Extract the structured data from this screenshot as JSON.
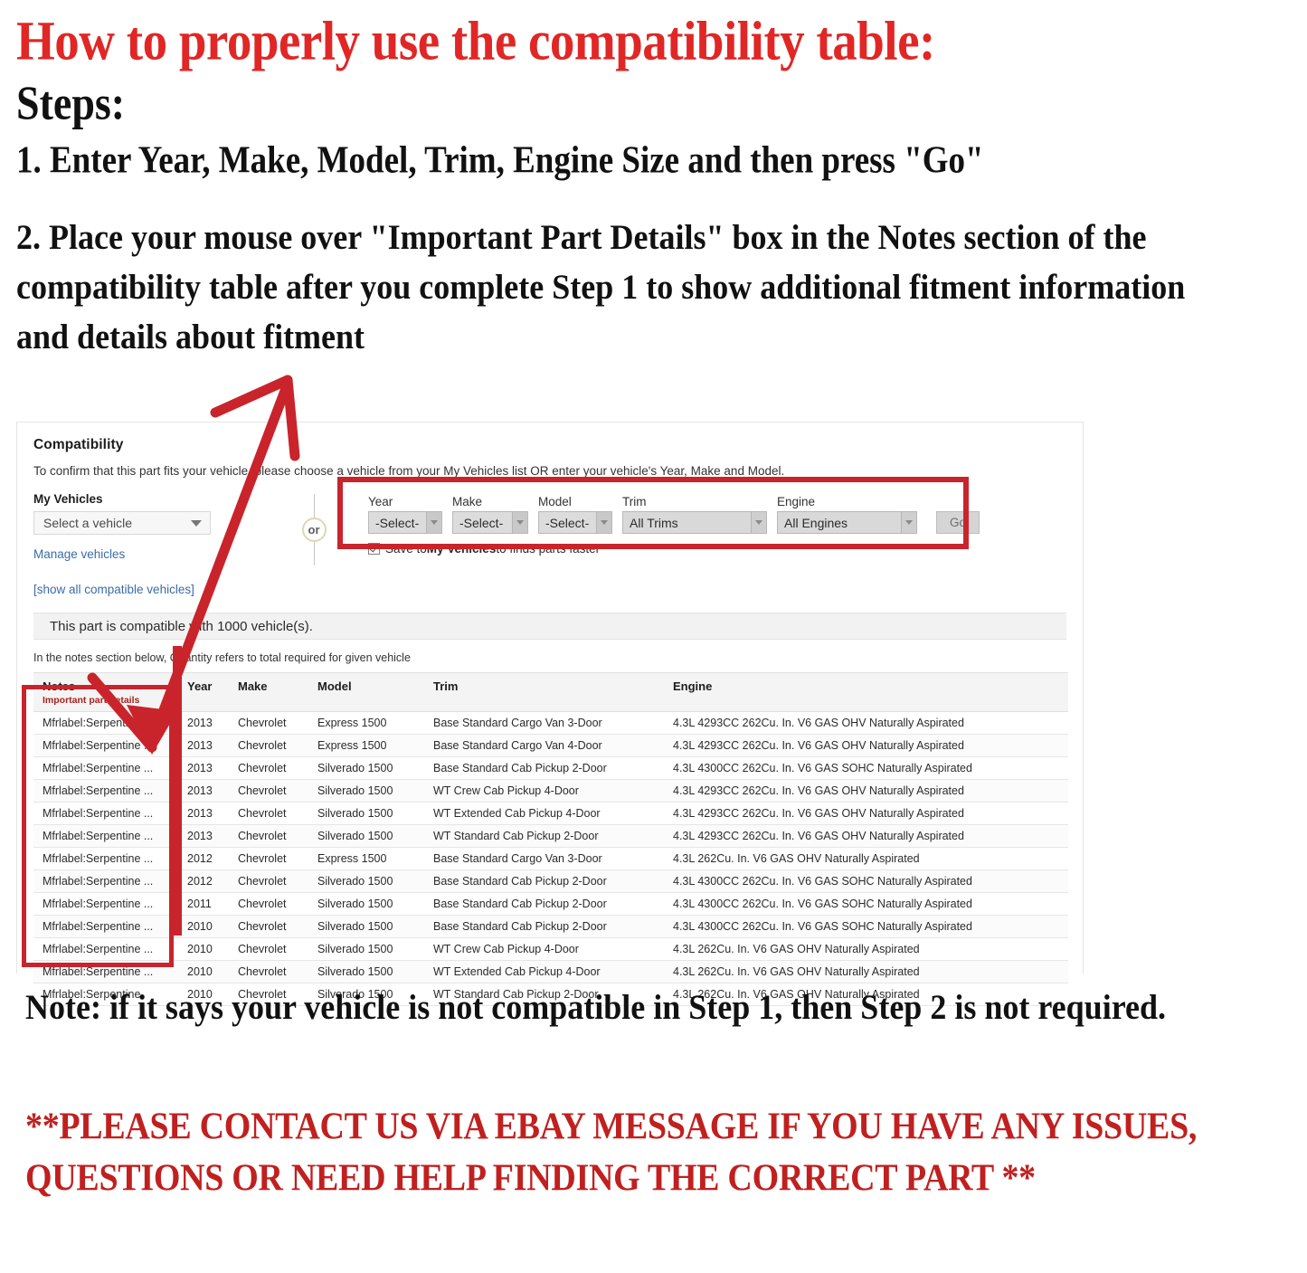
{
  "headline": {
    "title": "How to properly use the compatibility table:",
    "steps_label": "Steps:",
    "step_one": "1. Enter Year, Make, Model, Trim, Engine Size and then press \"Go\"",
    "step_two": "2. Place your mouse over \"Important Part Details\" box in the Notes section of the compatibility table after you complete Step 1 to show additional fitment information and details about fitment"
  },
  "widget": {
    "title": "Compatibility",
    "subtitle": "To confirm that this part fits your vehicle, please choose a vehicle from your My Vehicles list OR enter your vehicle's Year, Make and Model.",
    "my_vehicles": {
      "label": "My Vehicles",
      "select_value": "Select a vehicle",
      "manage_link": "Manage vehicles",
      "show_all_link": "[show all compatible vehicles]"
    },
    "or_divider": "or",
    "form": {
      "fields": [
        {
          "label": "Year",
          "value": "-Select-"
        },
        {
          "label": "Make",
          "value": "-Select-"
        },
        {
          "label": "Model",
          "value": "-Select-"
        },
        {
          "label": "Trim",
          "value": "All Trims"
        },
        {
          "label": "Engine",
          "value": "All Engines"
        }
      ],
      "go_label": "Go",
      "save_checkbox": {
        "checked": true,
        "text_before": "Save to ",
        "text_bold": "My Vehicles",
        "text_after": " to finds parts faster"
      }
    },
    "compat_banner": "This part is compatible with 1000 vehicle(s).",
    "qty_note": "In the notes section below, Quantity refers to total required for given vehicle"
  },
  "table": {
    "columns": [
      "Notes",
      "Year",
      "Make",
      "Model",
      "Trim",
      "Engine"
    ],
    "notes_subheader": "Important part details",
    "rows": [
      {
        "notes": "Mfrlabel:Serpentine ...",
        "year": "2013",
        "make": "Chevrolet",
        "model": "Express 1500",
        "trim": "Base Standard Cargo Van 3-Door",
        "engine": "4.3L 4293CC 262Cu. In. V6 GAS OHV Naturally Aspirated"
      },
      {
        "notes": "Mfrlabel:Serpentine ...",
        "year": "2013",
        "make": "Chevrolet",
        "model": "Express 1500",
        "trim": "Base Standard Cargo Van 4-Door",
        "engine": "4.3L 4293CC 262Cu. In. V6 GAS OHV Naturally Aspirated"
      },
      {
        "notes": "Mfrlabel:Serpentine ...",
        "year": "2013",
        "make": "Chevrolet",
        "model": "Silverado 1500",
        "trim": "Base Standard Cab Pickup 2-Door",
        "engine": "4.3L 4300CC 262Cu. In. V6 GAS SOHC Naturally Aspirated"
      },
      {
        "notes": "Mfrlabel:Serpentine ...",
        "year": "2013",
        "make": "Chevrolet",
        "model": "Silverado 1500",
        "trim": "WT Crew Cab Pickup 4-Door",
        "engine": "4.3L 4293CC 262Cu. In. V6 GAS OHV Naturally Aspirated"
      },
      {
        "notes": "Mfrlabel:Serpentine ...",
        "year": "2013",
        "make": "Chevrolet",
        "model": "Silverado 1500",
        "trim": "WT Extended Cab Pickup 4-Door",
        "engine": "4.3L 4293CC 262Cu. In. V6 GAS OHV Naturally Aspirated"
      },
      {
        "notes": "Mfrlabel:Serpentine ...",
        "year": "2013",
        "make": "Chevrolet",
        "model": "Silverado 1500",
        "trim": "WT Standard Cab Pickup 2-Door",
        "engine": "4.3L 4293CC 262Cu. In. V6 GAS OHV Naturally Aspirated"
      },
      {
        "notes": "Mfrlabel:Serpentine ...",
        "year": "2012",
        "make": "Chevrolet",
        "model": "Express 1500",
        "trim": "Base Standard Cargo Van 3-Door",
        "engine": "4.3L 262Cu. In. V6 GAS OHV Naturally Aspirated"
      },
      {
        "notes": "Mfrlabel:Serpentine ...",
        "year": "2012",
        "make": "Chevrolet",
        "model": "Silverado 1500",
        "trim": "Base Standard Cab Pickup 2-Door",
        "engine": "4.3L 4300CC 262Cu. In. V6 GAS SOHC Naturally Aspirated"
      },
      {
        "notes": "Mfrlabel:Serpentine ...",
        "year": "2011",
        "make": "Chevrolet",
        "model": "Silverado 1500",
        "trim": "Base Standard Cab Pickup 2-Door",
        "engine": "4.3L 4300CC 262Cu. In. V6 GAS SOHC Naturally Aspirated"
      },
      {
        "notes": "Mfrlabel:Serpentine ...",
        "year": "2010",
        "make": "Chevrolet",
        "model": "Silverado 1500",
        "trim": "Base Standard Cab Pickup 2-Door",
        "engine": "4.3L 4300CC 262Cu. In. V6 GAS SOHC Naturally Aspirated"
      },
      {
        "notes": "Mfrlabel:Serpentine ...",
        "year": "2010",
        "make": "Chevrolet",
        "model": "Silverado 1500",
        "trim": "WT Crew Cab Pickup 4-Door",
        "engine": "4.3L 262Cu. In. V6 GAS OHV Naturally Aspirated"
      },
      {
        "notes": "Mfrlabel:Serpentine ...",
        "year": "2010",
        "make": "Chevrolet",
        "model": "Silverado 1500",
        "trim": "WT Extended Cab Pickup 4-Door",
        "engine": "4.3L 262Cu. In. V6 GAS OHV Naturally Aspirated"
      },
      {
        "notes": "Mfrlabel:Serpentine",
        "year": "2010",
        "make": "Chevrolet",
        "model": "Silverado 1500",
        "trim": "WT Standard Cab Pickup 2-Door",
        "engine": "4.3L 262Cu. In. V6 GAS OHV Naturally Aspirated"
      }
    ]
  },
  "footer": {
    "note": "Note: if it says your vehicle is not compatible in Step 1, then Step 2 is not required.",
    "contact": "**PLEASE CONTACT US VIA EBAY MESSAGE IF YOU HAVE ANY ISSUES, QUESTIONS OR NEED HELP FINDING THE CORRECT PART **"
  },
  "colors": {
    "headline_red": "#e02726",
    "contact_red": "#c0201f",
    "annotation_red": "#c9242b",
    "link_blue": "#3a6ca8",
    "important_red": "#a5211f"
  }
}
